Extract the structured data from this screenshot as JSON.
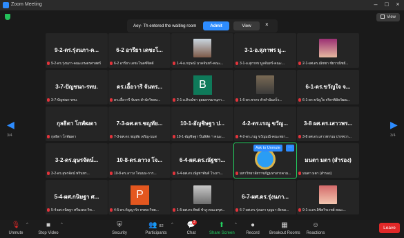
{
  "window": {
    "title": "Zoom Meeting"
  },
  "top": {
    "view_label": "View"
  },
  "notification": {
    "message": "Aey- Th entered the waiting room",
    "admit": "Admit",
    "view": "View",
    "close": "×"
  },
  "pages": {
    "left": "3/4",
    "right": "3/4"
  },
  "tiles": [
    {
      "big": "9-2-ดร.รุ่งนภา-ค...",
      "cap": "9-2-ดร.รุ่งนภา-คณะเกษตรศาสตร์"
    },
    {
      "big": "6-2 อารียา เดชะโ...",
      "cap": "6-2 อารียา เดชะโนดซ์จิตต์"
    },
    {
      "big": "",
      "cap": "1-4-อ.กฤษณ์ นาคจันทร์-คณะ..."
    },
    {
      "big": "3-1-อ.สุภาพร มู...",
      "cap": "3-1-อ.สุภาพร มูลจันทร์-คณะ..."
    },
    {
      "big": "",
      "cap": "2-1-ผศ.ดร.ณัชชา ชัยวาณิชย์..."
    },
    {
      "big": "3-7-ปัญชนก-รทบ.",
      "cap": "3-7-ปัญชนก-รทบ."
    },
    {
      "big": "ดร.เอื้อวารี จันทร...",
      "cap": "ดร.เอื้อวารี จันทร-สำนักวิทยบ..."
    },
    {
      "big": "",
      "cap": "2-1-อ.ดิรณ์ชา อุดมธรรมานุภา..."
    },
    {
      "big": "",
      "cap": "1-6-ดร.ชาคร ตัวทำนันสโร..."
    },
    {
      "big": "6-1-ดร.ขวัญใจ จ...",
      "cap": "6-1-ดร.ขวัญใจ จริยาพิลัยวัฒน..."
    },
    {
      "big": "กุลธิดา โกพัฒดา",
      "cap": "กุลธิดา โกพัฒดา"
    },
    {
      "big": "7-3-ผศ.ดร.ชญทัย...",
      "cap": "7-3-ผศ.ดร.ชญทัย เจริญ-บมส"
    },
    {
      "big": "10-1-อัญชิษฐา ป...",
      "cap": "10-1-อัญชิษฐา ปิ่นลิลัด ฯ คณะ..."
    },
    {
      "big": "4-2-ดร.เรณู ขวัญ...",
      "cap": "4-2-ดร.เรณู ขวัญมณี-คณะพยา..."
    },
    {
      "big": "3-8 ผศ.ดร.เสาวพร...",
      "cap": "3-8 ผศ.ดร.เสาวพรรณ ปาทพวา..."
    },
    {
      "big": "3-2-ดร.อุษรจัดน์...",
      "cap": "3-2-ดร.อุษรจัดน์ พรินทร..."
    },
    {
      "big": "10-8-ดร.ลาวง โจ...",
      "cap": "10-8-ดร.ลาวง โจนนม-การ..."
    },
    {
      "big": "6-4-ผศ.ดร.ณัฐชา...",
      "cap": "6-4-ผศ.ดร.ณัฐชาพันต์ โรงภา..."
    },
    {
      "big": "",
      "cap": "มหาวิทยาลัยราชภัฏมหาสารคาม..."
    },
    {
      "big": "มนตา มตา (สำรอง)",
      "cap": "มนตา มตา (สำรอง)"
    },
    {
      "big": "5-4-ผศ.กนิษฐา ศ...",
      "cap": "5-4-ผศ.กนิษฐา ศรีมงคล-วิท..."
    },
    {
      "big": "",
      "cap": "4-5-ดร.กัญญารัก ทรพล-วิทย..."
    },
    {
      "big": "",
      "cap": "1-5-ผศ.ดร.ทิพย์ ชำภู-คณะครุศ..."
    },
    {
      "big": "6-7-ผศ.ดร.รุ่งนภา...",
      "cap": "6-7-ผศ.ดร.รุ่งนภา บุญมา-สังคม..."
    },
    {
      "big": "",
      "cap": "9-1-อ.ดร.ลิขิตวิรเวทย์ คณะ..."
    }
  ],
  "letters": {
    "b": "B",
    "p": "P"
  },
  "ask_to_unmute": "Ask to Unmute",
  "ask_more": "···",
  "toolbar": {
    "unmute": "Unmute",
    "stop_video": "Stop Video",
    "security": "Security",
    "participants": "Participants",
    "participants_count": "82",
    "chat": "Chat",
    "chat_badge": "2",
    "share": "Share Screen",
    "record": "Record",
    "breakout": "Breakout Rooms",
    "reactions": "Reactions",
    "leave": "Leave"
  },
  "colors": {
    "accent": "#2d8cff",
    "leave": "#e02828",
    "share": "#23d160"
  }
}
